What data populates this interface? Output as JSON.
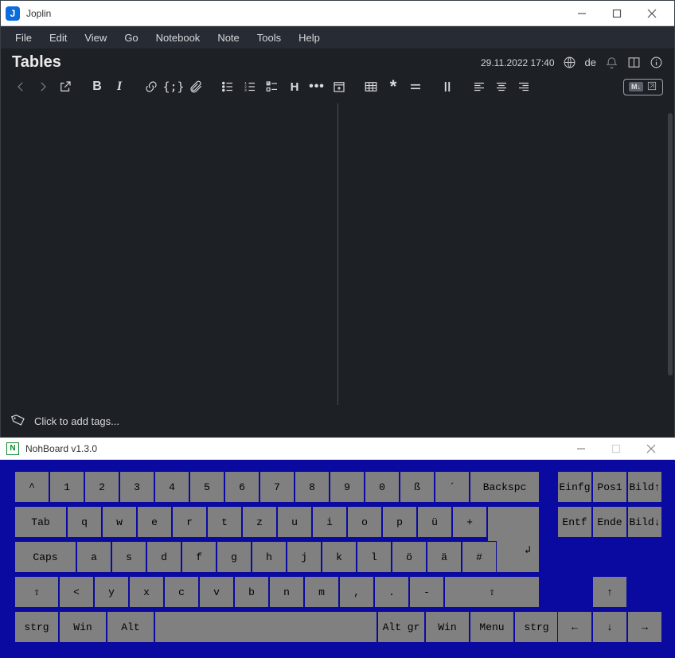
{
  "joplin": {
    "app_name": "Joplin",
    "menubar": [
      "File",
      "Edit",
      "View",
      "Go",
      "Notebook",
      "Note",
      "Tools",
      "Help"
    ],
    "note_title": "Tables",
    "timestamp": "29.11.2022 17:40",
    "language": "de",
    "tags_placeholder": "Click to add tags...",
    "md_label": "M↓"
  },
  "nohboard": {
    "title": "NohBoard v1.3.0",
    "keys_row1": [
      "^",
      "1",
      "2",
      "3",
      "4",
      "5",
      "6",
      "7",
      "8",
      "9",
      "0",
      "ß",
      "´",
      "Backspc"
    ],
    "keys_row2_head": "Tab",
    "keys_row2": [
      "q",
      "w",
      "e",
      "r",
      "t",
      "z",
      "u",
      "i",
      "o",
      "p",
      "ü",
      "+"
    ],
    "keys_enter": "↲",
    "keys_row3_head": "Caps",
    "keys_row3": [
      "a",
      "s",
      "d",
      "f",
      "g",
      "h",
      "j",
      "k",
      "l",
      "ö",
      "ä",
      "#"
    ],
    "keys_row4_lshift": "⇧",
    "keys_row4": [
      "<",
      "y",
      "x",
      "c",
      "v",
      "b",
      "n",
      "m",
      ",",
      ".",
      "-"
    ],
    "keys_row4_rshift": "⇧",
    "keys_row5": [
      "strg",
      "Win",
      "Alt",
      "",
      "Alt gr",
      "Win",
      "Menu",
      "strg"
    ],
    "nav_top": [
      "Einfg",
      "Pos1",
      "Bild↑"
    ],
    "nav_bottom": [
      "Entf",
      "Ende",
      "Bild↓"
    ],
    "arrows": {
      "up": "↑",
      "left": "←",
      "down": "↓",
      "right": "→"
    }
  }
}
